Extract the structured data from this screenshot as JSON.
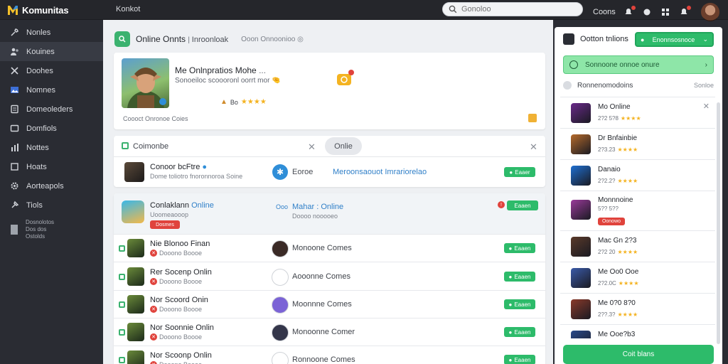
{
  "brand": {
    "name": "Komunitas",
    "logo_colors": [
      "#f4c02a",
      "#3b8fd8"
    ]
  },
  "top_nav": {
    "label": "Konkot"
  },
  "search": {
    "placeholder": "Gonoloo"
  },
  "top_right": {
    "link": "Coons"
  },
  "sidebar": {
    "items": [
      {
        "label": "Nonles",
        "icon": "wrench-icon"
      },
      {
        "label": "Kouines",
        "icon": "people-icon",
        "active": true
      },
      {
        "label": "Doohes",
        "icon": "tools-icon"
      },
      {
        "label": "Nomnes",
        "icon": "flag-icon"
      },
      {
        "label": "Domeoleders",
        "icon": "document-icon"
      },
      {
        "label": "Domfiols",
        "icon": "folder-icon"
      },
      {
        "label": "Nottes",
        "icon": "chart-icon"
      },
      {
        "label": "Hoats",
        "icon": "box-icon"
      },
      {
        "label": "Aorteapols",
        "icon": "gear-icon"
      },
      {
        "label": "Tiols",
        "icon": "pin-icon"
      }
    ],
    "footer": [
      "Dosnolotos",
      "Dos dos",
      "Ostolds"
    ]
  },
  "main": {
    "title": "Online Onnts",
    "title_suffix": "Inroonloak",
    "subtitle": "Ooon Onnoonioo",
    "featured": {
      "title": "Me Onlnpratios Mohe",
      "title_suffix": "...",
      "description": "Sonoeiloc scoooronl oorrt mor",
      "rating_label": "Bo",
      "stars": "★★★★",
      "caption": "Coooct Onronoe Coies"
    },
    "compose": {
      "tab_label": "Coimonbe",
      "pill": "Onlie",
      "name": "Conoor bcFtre",
      "subtitle": "Dome toliotro fnoronnoroa Soine",
      "action_label": "Eoroe",
      "action_link": "Meroonsaouot Imrariorelao",
      "button": "Eaaer"
    },
    "list_header": {
      "name": "Conlaklann",
      "name_accent": "Online",
      "sub": "Uoomeaooop",
      "tag": "Dosmes",
      "center_prefix": "Ooo",
      "center_title": "Mahar : Online",
      "center_sub": "Doooo nooooeo",
      "button": "Eaaen"
    },
    "rows": [
      {
        "name": "Nie Blonoo Finan",
        "meta": "Dooono Boooe",
        "center": "Monoone Comes",
        "button": "Eaaen",
        "icon_bg": "#3a2a26"
      },
      {
        "name": "Rer Socenp Onlin",
        "meta": "Dooono Boooe",
        "center": "Aooonne Comes",
        "button": "Eaaen",
        "icon_bg": "#ffffff"
      },
      {
        "name": "Nor Scoord Onin",
        "meta": "Dooono Boooe",
        "center": "Moonnne Comes",
        "button": "Eaaen",
        "icon_bg": "#7b63d6"
      },
      {
        "name": "Nor Soonnie Onlin",
        "meta": "Dooono Boooe",
        "center": "Monoonne Comer",
        "button": "Eaaen",
        "icon_bg": "#34364a"
      },
      {
        "name": "Nor Scoonp Onlin",
        "meta": "Dooono Boooe",
        "center": "Ronnoone Comes",
        "button": "Eaaen",
        "icon_bg": "#ffffff"
      }
    ]
  },
  "rpanel": {
    "header": "Ootton tnlions",
    "dropdown": "Enonnsosnoce",
    "banner": "Sonnoone onnoe onure",
    "section": "Ronnenomodoins",
    "section_more": "Sonloe",
    "items": [
      {
        "title": "Mo Online",
        "meta": "2?2 5?8",
        "stars": "★★★★",
        "color": "#6a2a8a"
      },
      {
        "title": "Dr Bnfainbie",
        "meta": "2?3.23",
        "stars": "★★★★",
        "color": "#b56a2b"
      },
      {
        "title": "Danaio",
        "meta": "2?2.2?",
        "stars": "★★★★",
        "color": "#1f6fd0"
      },
      {
        "title": "Monnnoine",
        "meta": "5?? 5??",
        "stars": "",
        "color": "#9a3a9a",
        "tag": "Oonowo"
      },
      {
        "title": "Mac Gn 2?3",
        "meta": "2?2 20",
        "stars": "★★★★",
        "color": "#5a3a2a"
      },
      {
        "title": "Me Oo0 Ooe",
        "meta": "2?2.0C",
        "stars": "★★★★",
        "color": "#3a5aa8"
      },
      {
        "title": "Me 0?0 8?0",
        "meta": "2??.3?",
        "stars": "★★★★",
        "color": "#8a3a2a"
      },
      {
        "title": "Me Ooe?b3",
        "meta": "2??.2?",
        "stars": "★★★★",
        "color": "#2a4a8a"
      }
    ],
    "cta": "Coit blans"
  },
  "colors": {
    "accent": "#2dbb6a",
    "sidebar": "#2a2c33",
    "topbar": "#25262b",
    "danger": "#e0433c",
    "star": "#f4b321"
  }
}
